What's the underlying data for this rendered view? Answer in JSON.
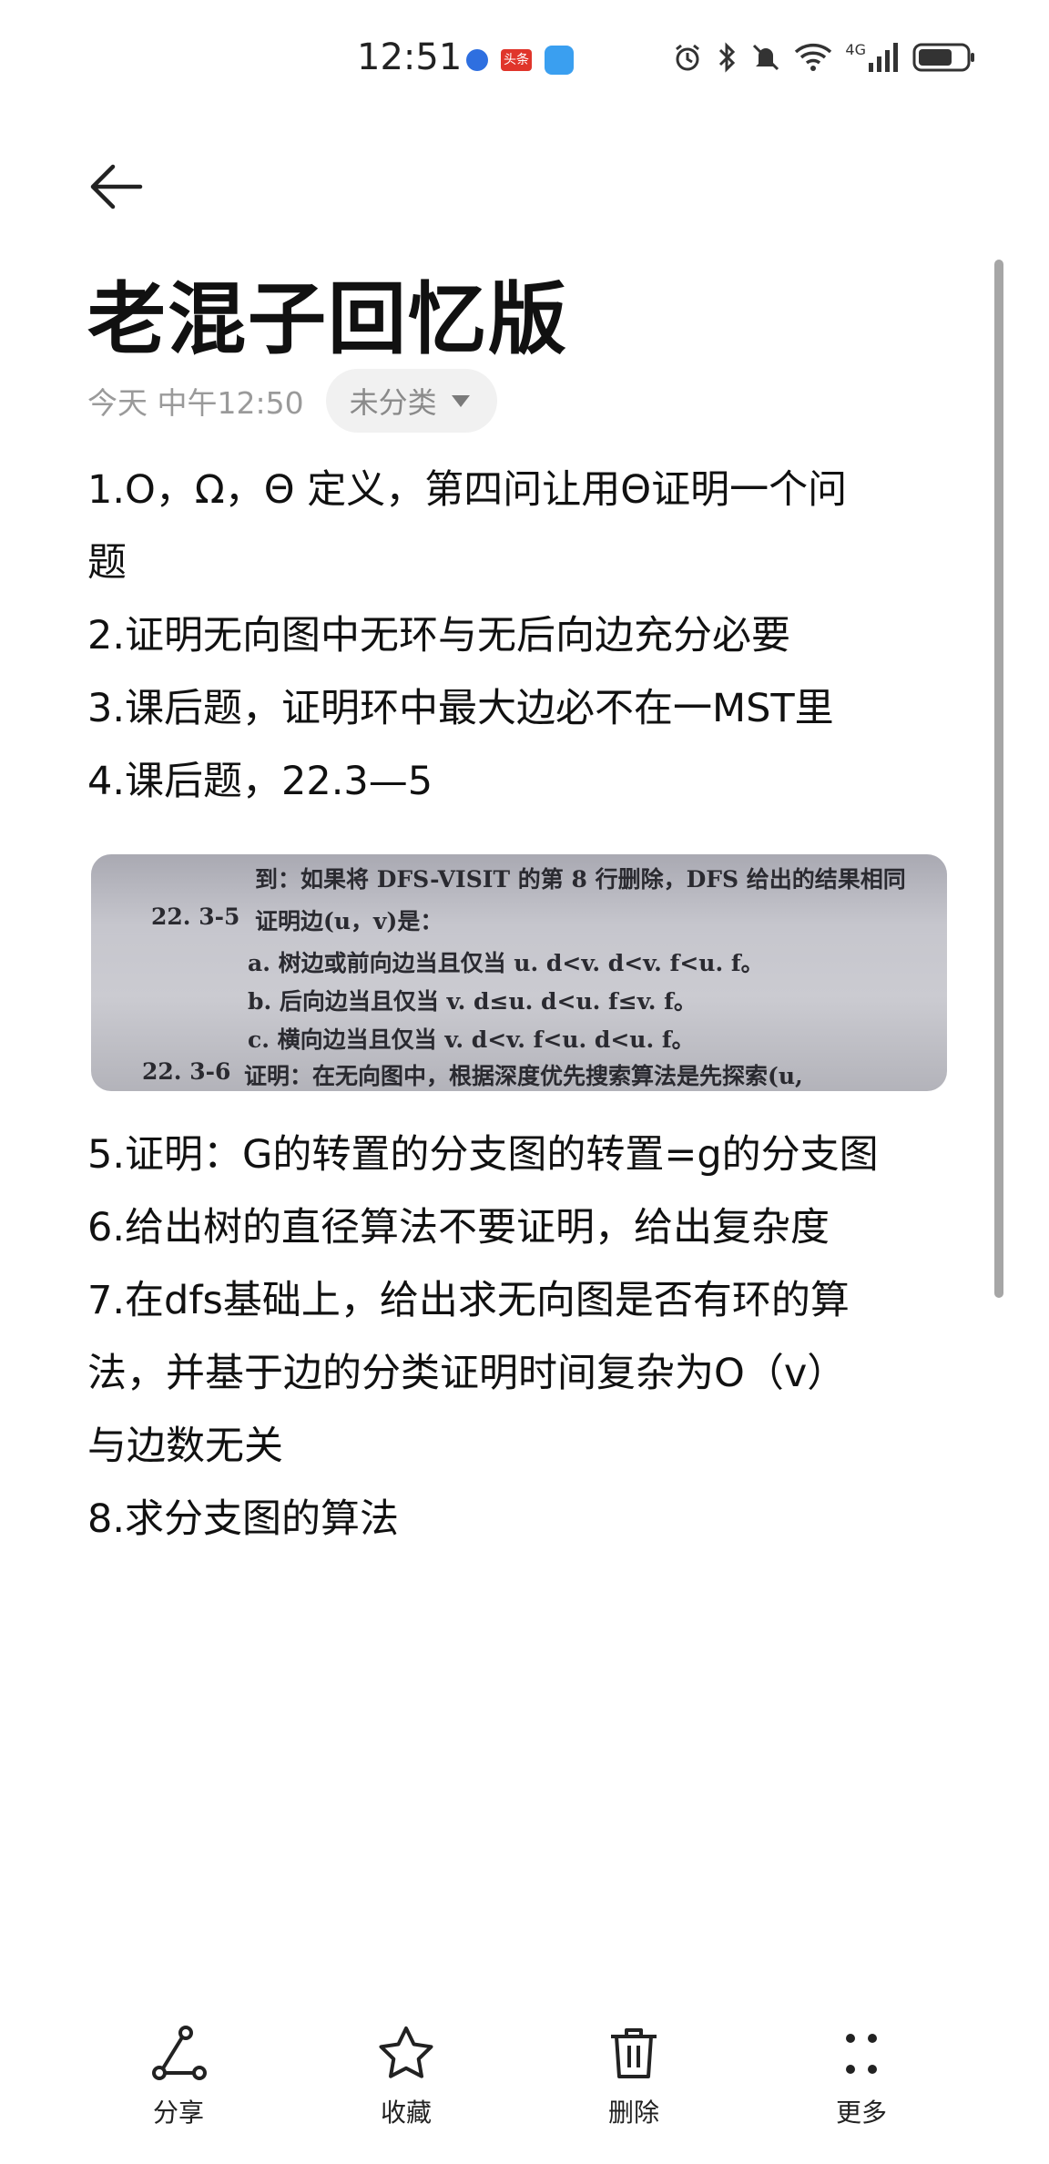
{
  "status_bar": {
    "time": "12:51",
    "toutiao_label": "头条",
    "network": "4G"
  },
  "header": {
    "title": "老混子回忆版",
    "date": "今天 中午12:50",
    "category": "未分类"
  },
  "content": {
    "lines_top": [
      "1.O，Ω，Θ 定义，第四问让用Θ证明一个问",
      "题",
      "2.证明无向图中无环与无后向边充分必要",
      "3.课后题，证明环中最大边必不在一MST里",
      "4.课后题，22.3—5"
    ],
    "photo_lines": [
      "到：如果将 DFS-VISIT 的第 8 行删除，DFS 给出的结果相同",
      "22. 3-5",
      "证明边(u，v)是：",
      "a. 树边或前向边当且仅当 u. d<v. d<v. f<u. f。",
      "b. 后向边当且仅当 v. d≤u. d<u. f≤v. f。",
      "c. 横向边当且仅当 v. d<v. f<u. d<u. f。",
      "22. 3-6",
      "证明：在无向图中，根据深度优先搜索算法是先探索(u,"
    ],
    "lines_bottom": [
      "5.证明：G的转置的分支图的转置=g的分支图",
      "6.给出树的直径算法不要证明，给出复杂度",
      "7.在dfs基础上，给出求无向图是否有环的算",
      "法，并基于边的分类证明时间复杂为O（v）",
      "与边数无关",
      "8.求分支图的算法"
    ]
  },
  "toolbar": {
    "share": "分享",
    "favorite": "收藏",
    "delete": "删除",
    "more": "更多"
  },
  "icons": {
    "back": "arrow-left-icon",
    "share": "share-icon",
    "favorite": "star-icon",
    "delete": "trash-icon",
    "more": "more-dots-icon"
  }
}
